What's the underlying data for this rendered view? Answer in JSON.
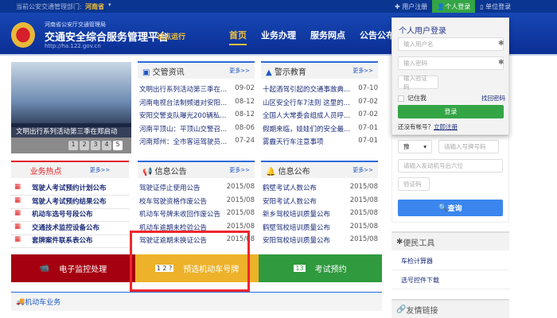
{
  "topbar": {
    "dept_label": "当前公安交通管理部门:",
    "dept_value": "河南省",
    "register": "用户注册",
    "personal_login": "个人登录",
    "unit_login": "单位登录"
  },
  "header": {
    "bureau": "河南省公安厅交通管理局",
    "title": "交通安全综合服务管理平台",
    "trial": "试点运行",
    "url": "http://ha.122.gov.cn",
    "nav": [
      "首页",
      "业务办理",
      "服务网点",
      "公告公布"
    ]
  },
  "login": {
    "title": "个人用户登录",
    "username_ph": "输入用户名",
    "password_ph": "输入密码",
    "captcha_ph": "输入验证码",
    "remember": "记住我",
    "forgot": "找回密码",
    "submit": "登录",
    "no_account": "还没有帐号？",
    "register_now": "立即注册"
  },
  "slider": {
    "caption": "文明出行系列活动第三季在郑启动",
    "pages": [
      "1",
      "2",
      "3",
      "4",
      "5"
    ],
    "active": "5"
  },
  "news": {
    "title": "交管资讯",
    "more": "更多>>",
    "items": [
      {
        "t": "文明出行系列活动第三季在...",
        "d": "09-02"
      },
      {
        "t": "河南电视台法制频道对安阳...",
        "d": "08-12"
      },
      {
        "t": "安阳交警支队曝光200辆私...",
        "d": "08-12"
      },
      {
        "t": "河南平顶山：平顶山交警召...",
        "d": "08-06"
      },
      {
        "t": "河南郑州：全市客运驾驶员...",
        "d": "07-24"
      }
    ]
  },
  "warning": {
    "title": "警示教育",
    "more": "更多>>",
    "items": [
      {
        "t": "十起酒驾引起的交通事故典...",
        "d": "07-10"
      },
      {
        "t": "山区安全行车7法则 这里的...",
        "d": "07-02"
      },
      {
        "t": "全国人大常委会组成人员呼...",
        "d": "07-02"
      },
      {
        "t": "假期来临，娃娃们的安全最...",
        "d": "07-01"
      },
      {
        "t": "雾霾天行车注意事项",
        "d": "07-01"
      }
    ]
  },
  "hot": {
    "title": "业务热点",
    "more": "更多>>",
    "items": [
      "驾驶人考试预约计划公布",
      "驾驶人考试预约结果公布",
      "机动车选号号段公布",
      "交通技术监控设备公布",
      "套牌案件联系表公布"
    ]
  },
  "notice": {
    "title": "信息公告",
    "more": "更多>>",
    "items": [
      {
        "t": "驾驶证停止使用公告",
        "d": "2015/08"
      },
      {
        "t": "校车驾驶资格作废公告",
        "d": "2015/08"
      },
      {
        "t": "机动车号牌未收回作废公告",
        "d": "2015/08"
      },
      {
        "t": "机动车逾期未检验公告",
        "d": "2015/08"
      },
      {
        "t": "驾驶证逾期未换证公告",
        "d": "2015/08"
      }
    ]
  },
  "info": {
    "title": "信息公布",
    "more": "更多>>",
    "items": [
      {
        "t": "鹤壁考试人数公布",
        "d": "2015/08"
      },
      {
        "t": "安阳考试人数公布",
        "d": "2015/08"
      },
      {
        "t": "新乡驾校培训质量公布",
        "d": "2015/08"
      },
      {
        "t": "鹤壁驾校培训质量公布",
        "d": "2015/08"
      },
      {
        "t": "安阳驾校培训质量公布",
        "d": "2015/08"
      }
    ]
  },
  "banners": [
    {
      "label": "电子监控处理",
      "color": "#a50010"
    },
    {
      "label": "预选机动车号牌",
      "color": "#edb22a"
    },
    {
      "label": "考试预约",
      "color": "#2f9a3e"
    }
  ],
  "vehicle": {
    "section": "机动车业务"
  },
  "query": {
    "province": "豫",
    "plate_ph": "请输入号牌号码",
    "engine_ph": "请输入发动机号后六位",
    "captcha_ph": "验证码",
    "button": "查询"
  },
  "tools": {
    "title": "便民工具",
    "items": [
      "车检计算器",
      "选号控件下载"
    ]
  },
  "links": {
    "title": "友情链接"
  },
  "colors": {
    "nav_blue": "#0b3590",
    "accent_green": "#33a544",
    "query_blue": "#3a86ee",
    "highlight": "#f0262d"
  }
}
